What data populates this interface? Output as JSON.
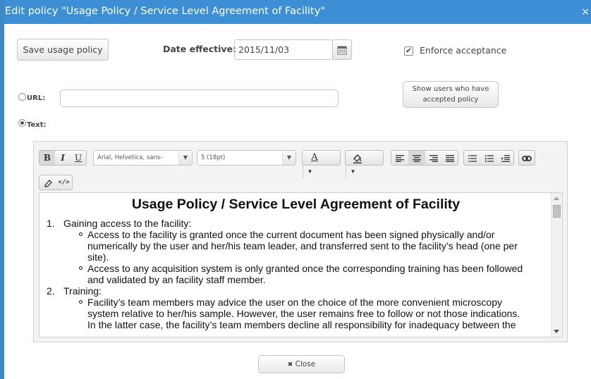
{
  "dialog": {
    "title": "Edit policy \"Usage Policy / Service Level Agreement of Facility\"",
    "close_glyph": "×"
  },
  "form": {
    "save_label": "Save usage policy",
    "date_label": "Date effective:",
    "date_value": "2015/11/03",
    "enforce_label": "Enforce acceptance",
    "enforce_checked": true,
    "url_label": "URL:",
    "url_value": "",
    "text_label": "Text:",
    "selected_source": "text",
    "show_users_line1": "Show users who have",
    "show_users_line2": "accepted policy"
  },
  "toolbar": {
    "bold": "B",
    "italic": "I",
    "underline": "U",
    "font_family": "Arial, Helvetica, sans-",
    "font_size": "5 (18pt)",
    "text_color_glyph": "A"
  },
  "document": {
    "title": "Usage Policy / Service Level Agreement of Facility",
    "sections": [
      {
        "num": "1.",
        "heading": "Gaining access to the facility:",
        "bullets": [
          [
            "Access to the facility is granted once the current document has been signed physically and/or",
            "numerically by the user and her/his team leader, and transferred sent to the facility’s head (one per",
            "site)."
          ],
          [
            "Access to any acquisition system is only granted once the corresponding training has been followed",
            "and validated by an facility staff member."
          ]
        ]
      },
      {
        "num": "2.",
        "heading": "Training:",
        "bullets": [
          [
            "Facility’s team members may advice the user on the choice of the more convenient microscopy",
            "system relative to her/his sample. However, the user remains free to follow or not those indications.",
            "In the latter case, the facility’s team members decline all responsibility for inadequacy between the"
          ]
        ]
      }
    ]
  },
  "footer": {
    "close_glyph": "✖",
    "close_label": "Close"
  },
  "colors": {
    "titlebar": "#3c8fd4",
    "border": "#3f88c8"
  }
}
